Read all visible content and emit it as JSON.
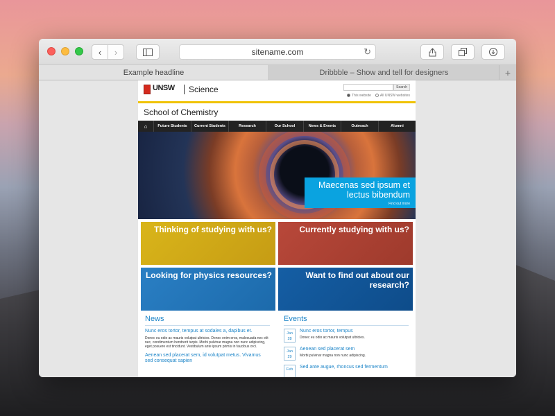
{
  "browser": {
    "address": "sitename.com",
    "tabs": [
      {
        "label": "Example headline"
      },
      {
        "label": "Dribbble – Show and tell for designers"
      }
    ],
    "new_tab_symbol": "+"
  },
  "site": {
    "logo_text": "UNSW",
    "faculty": "Science",
    "search_button": "Search",
    "radio_options": [
      "This website",
      "All UNSW websites"
    ],
    "school": "School of Chemistry",
    "nav": [
      "Future Students",
      "Current Students",
      "Research",
      "Our School",
      "News & Events",
      "Outreach",
      "Alumni"
    ],
    "hero": {
      "title": "Maecenas sed ipsum et lectus bibendum",
      "link": "Find out more"
    },
    "tiles": [
      {
        "label": "Thinking of studying with us?"
      },
      {
        "label": "Currently studying with us?"
      },
      {
        "label": "Looking for physics resources?"
      },
      {
        "label": "Want to find out about our research?"
      }
    ],
    "news": {
      "heading": "News",
      "items": [
        {
          "title": "Nunc eros tortor, tempus at sodales a, dapibus et.",
          "body": "Donec eu odio ac mauris volutpat ultricies. Donec enim eros, malesuada nec elit nec, condimentum hendrerit turpis. Morbi pulvinar magna non nunc adipiscing, eget posuere est tincidunt. Vestibulum ante ipsum primis in faucibus orci."
        },
        {
          "title": "Aenean sed placerat sem, id volutpat metus. Vivamus sed consequat sapien",
          "body": ""
        }
      ]
    },
    "events": {
      "heading": "Events",
      "items": [
        {
          "month": "Jan",
          "day": "28",
          "title": "Nunc eros tortor, tempus",
          "desc": "Donec eu odio ac mauris volutpat ultricies."
        },
        {
          "month": "Jan",
          "day": "29",
          "title": "Aenean sed placerat sem",
          "desc": "Morbi pulvinar magna non nunc adipiscing."
        },
        {
          "month": "Feb",
          "day": "",
          "title": "Sed ante augue, rhoncus sed fermentum",
          "desc": ""
        }
      ]
    }
  },
  "colors": {
    "accent_blue": "#1d85c8",
    "hero_box": "#0aa3e0",
    "yellow_bar": "#f0c200",
    "nav_bg": "#232323"
  },
  "icons": {
    "back": "chevron-left-icon",
    "forward": "chevron-right-icon",
    "sidebar": "sidebar-icon",
    "reload": "reload-icon",
    "share": "share-icon",
    "tabs": "tabs-overview-icon",
    "downloads": "download-icon",
    "home": "home-icon"
  }
}
